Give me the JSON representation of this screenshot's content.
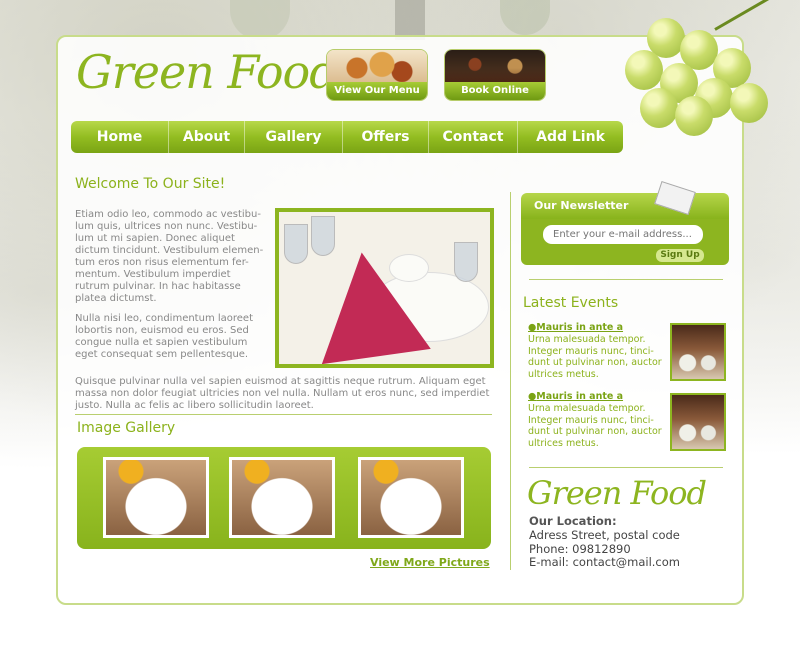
{
  "site": {
    "logo_text": "Green Food",
    "accent_color": "#8db520"
  },
  "promos": [
    {
      "label": "View Our Menu",
      "icon": "menu-food-photo"
    },
    {
      "label": "Book Online",
      "icon": "restaurant-photo"
    }
  ],
  "nav": {
    "items": [
      "Home",
      "About",
      "Gallery",
      "Offers",
      "Contact",
      "Add Link"
    ]
  },
  "main": {
    "welcome_title": "Welcome To Our Site!",
    "para1": "Etiam odio leo, commodo ac vestibu-lum quis, ultrices non nunc. Vestibu-lum ut mi sapien. Donec aliquet dictum tincidunt. Vestibulum elemen-tum eros non risus elementum fer-mentum. Vestibulum imperdiet rutrum pulvinar. In hac habitasse platea dictumst.",
    "para2": "Nulla nisi leo, condimentum laoreet lobortis non, euismod eu eros. Sed congue nulla et sapien vestibulum eget consequat sem pellentesque.",
    "para3": "Quisque pulvinar nulla vel sapien euismod at sagittis neque rutrum. Aliquam eget massa non dolor feugiat ultricies non vel nulla. Nullam ut eros nunc, sed imperdiet justo. Nulla ac felis ac libero sollicitudin laoreet.",
    "gallery_title": "Image Gallery",
    "view_more": "View More Pictures"
  },
  "sidebar": {
    "newsletter_title": "Our Newsletter",
    "email_placeholder": "Enter your e-mail address...",
    "signup_label": "Sign Up",
    "events_title": "Latest Events",
    "events": [
      {
        "title": "Mauris in ante a",
        "text": "Urna malesuada tempor. Integer mauris nunc, tinci-dunt ut pulvinar non, auctor ultrices metus."
      },
      {
        "title": "Mauris in ante a",
        "text": "Urna malesuada tempor. Integer mauris nunc, tinci-dunt ut pulvinar non, auctor ultrices metus."
      }
    ],
    "footer_logo": "Green Food",
    "location_label": "Our Location:",
    "address": "Adress Street, postal code",
    "phone": "Phone: 09812890",
    "email": "E-mail: contact@mail.com"
  }
}
